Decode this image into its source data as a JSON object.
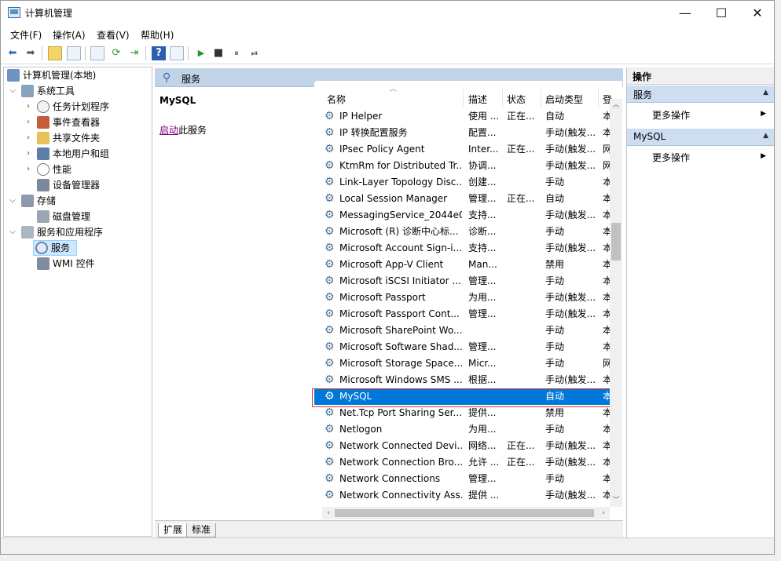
{
  "window": {
    "title": "计算机管理",
    "minimize": "—",
    "maximize": "☐",
    "close": "✕"
  },
  "menu": [
    {
      "label": "文件(F)"
    },
    {
      "label": "操作(A)"
    },
    {
      "label": "查看(V)"
    },
    {
      "label": "帮助(H)"
    }
  ],
  "toolbar": {
    "icons": [
      "back-icon",
      "forward-icon",
      "up-folder-icon",
      "show-hide-tree-icon",
      "properties-icon",
      "refresh-icon",
      "export-icon",
      "help-icon",
      "view-icon",
      "play-icon",
      "stop-icon",
      "pause-icon",
      "restart-icon"
    ],
    "back": "⬅",
    "forward": "➡",
    "play": "▶",
    "stop": "■",
    "pause": "⏸",
    "restart": "⏯",
    "help": "?"
  },
  "tree": [
    {
      "label": "计算机管理(本地)",
      "toggle": "",
      "level": 0
    },
    {
      "label": "系统工具",
      "toggle": "⌵",
      "level": 1
    },
    {
      "label": "任务计划程序",
      "toggle": "›",
      "level": 2
    },
    {
      "label": "事件查看器",
      "toggle": "›",
      "level": 2
    },
    {
      "label": "共享文件夹",
      "toggle": "›",
      "level": 2
    },
    {
      "label": "本地用户和组",
      "toggle": "›",
      "level": 2
    },
    {
      "label": "性能",
      "toggle": "›",
      "level": 2
    },
    {
      "label": "设备管理器",
      "toggle": "",
      "level": 2
    },
    {
      "label": "存储",
      "toggle": "⌵",
      "level": 1
    },
    {
      "label": "磁盘管理",
      "toggle": "",
      "level": 2
    },
    {
      "label": "服务和应用程序",
      "toggle": "⌵",
      "level": 1
    },
    {
      "label": "服务",
      "toggle": "",
      "level": 2,
      "selected": true
    },
    {
      "label": "WMI 控件",
      "toggle": "",
      "level": 2
    }
  ],
  "middle": {
    "header": "服务",
    "selected_service": "MySQL",
    "start_link": "启动",
    "start_suffix": "此服务"
  },
  "columns": {
    "name": "名称",
    "desc": "描述",
    "status": "状态",
    "startup": "启动类型",
    "logon": "登"
  },
  "services": [
    {
      "name": "IP Helper",
      "desc": "使用 ...",
      "status": "正在...",
      "startup": "自动",
      "logon": "本"
    },
    {
      "name": "IP 转换配置服务",
      "desc": "配置...",
      "status": "",
      "startup": "手动(触发...",
      "logon": "本"
    },
    {
      "name": "IPsec Policy Agent",
      "desc": "Inter...",
      "status": "正在...",
      "startup": "手动(触发...",
      "logon": "网"
    },
    {
      "name": "KtmRm for Distributed Tr...",
      "desc": "协调...",
      "status": "",
      "startup": "手动(触发...",
      "logon": "网"
    },
    {
      "name": "Link-Layer Topology Disc...",
      "desc": "创建...",
      "status": "",
      "startup": "手动",
      "logon": "本"
    },
    {
      "name": "Local Session Manager",
      "desc": "管理...",
      "status": "正在...",
      "startup": "自动",
      "logon": "本"
    },
    {
      "name": "MessagingService_2044e0",
      "desc": "支持...",
      "status": "",
      "startup": "手动(触发...",
      "logon": "本"
    },
    {
      "name": "Microsoft (R) 诊断中心标...",
      "desc": "诊断...",
      "status": "",
      "startup": "手动",
      "logon": "本"
    },
    {
      "name": "Microsoft Account Sign-i...",
      "desc": "支持...",
      "status": "",
      "startup": "手动(触发...",
      "logon": "本"
    },
    {
      "name": "Microsoft App-V Client",
      "desc": "Man...",
      "status": "",
      "startup": "禁用",
      "logon": "本"
    },
    {
      "name": "Microsoft iSCSI Initiator ...",
      "desc": "管理...",
      "status": "",
      "startup": "手动",
      "logon": "本"
    },
    {
      "name": "Microsoft Passport",
      "desc": "为用...",
      "status": "",
      "startup": "手动(触发...",
      "logon": "本"
    },
    {
      "name": "Microsoft Passport Cont...",
      "desc": "管理...",
      "status": "",
      "startup": "手动(触发...",
      "logon": "本"
    },
    {
      "name": "Microsoft SharePoint Wo...",
      "desc": "",
      "status": "",
      "startup": "手动",
      "logon": "本"
    },
    {
      "name": "Microsoft Software Shad...",
      "desc": "管理...",
      "status": "",
      "startup": "手动",
      "logon": "本"
    },
    {
      "name": "Microsoft Storage Space...",
      "desc": "Micr...",
      "status": "",
      "startup": "手动",
      "logon": "网"
    },
    {
      "name": "Microsoft Windows SMS ...",
      "desc": "根据...",
      "status": "",
      "startup": "手动(触发...",
      "logon": "本"
    },
    {
      "name": "MySQL",
      "desc": "",
      "status": "",
      "startup": "自动",
      "logon": "本",
      "selected": true
    },
    {
      "name": "Net.Tcp Port Sharing Ser...",
      "desc": "提供...",
      "status": "",
      "startup": "禁用",
      "logon": "本"
    },
    {
      "name": "Netlogon",
      "desc": "为用...",
      "status": "",
      "startup": "手动",
      "logon": "本"
    },
    {
      "name": "Network Connected Devi...",
      "desc": "网络...",
      "status": "正在...",
      "startup": "手动(触发...",
      "logon": "本"
    },
    {
      "name": "Network Connection Bro...",
      "desc": "允许 ...",
      "status": "正在...",
      "startup": "手动(触发...",
      "logon": "本"
    },
    {
      "name": "Network Connections",
      "desc": "管理...",
      "status": "",
      "startup": "手动",
      "logon": "本"
    },
    {
      "name": "Network Connectivity Ass...",
      "desc": "提供 ...",
      "status": "",
      "startup": "手动(触发...",
      "logon": "本"
    }
  ],
  "tabs": [
    {
      "label": "扩展"
    },
    {
      "label": "标准"
    }
  ],
  "actions": {
    "title": "操作",
    "groups": [
      {
        "label": "服务",
        "items": [
          "更多操作"
        ]
      },
      {
        "label": "MySQL",
        "items": [
          "更多操作"
        ]
      }
    ]
  },
  "colors": {
    "selection": "#0078d7",
    "highlight_outline": "#e0312f",
    "header_blue": "#c1d3e6",
    "group_blue": "#cedef2",
    "link_visited": "#800080"
  }
}
